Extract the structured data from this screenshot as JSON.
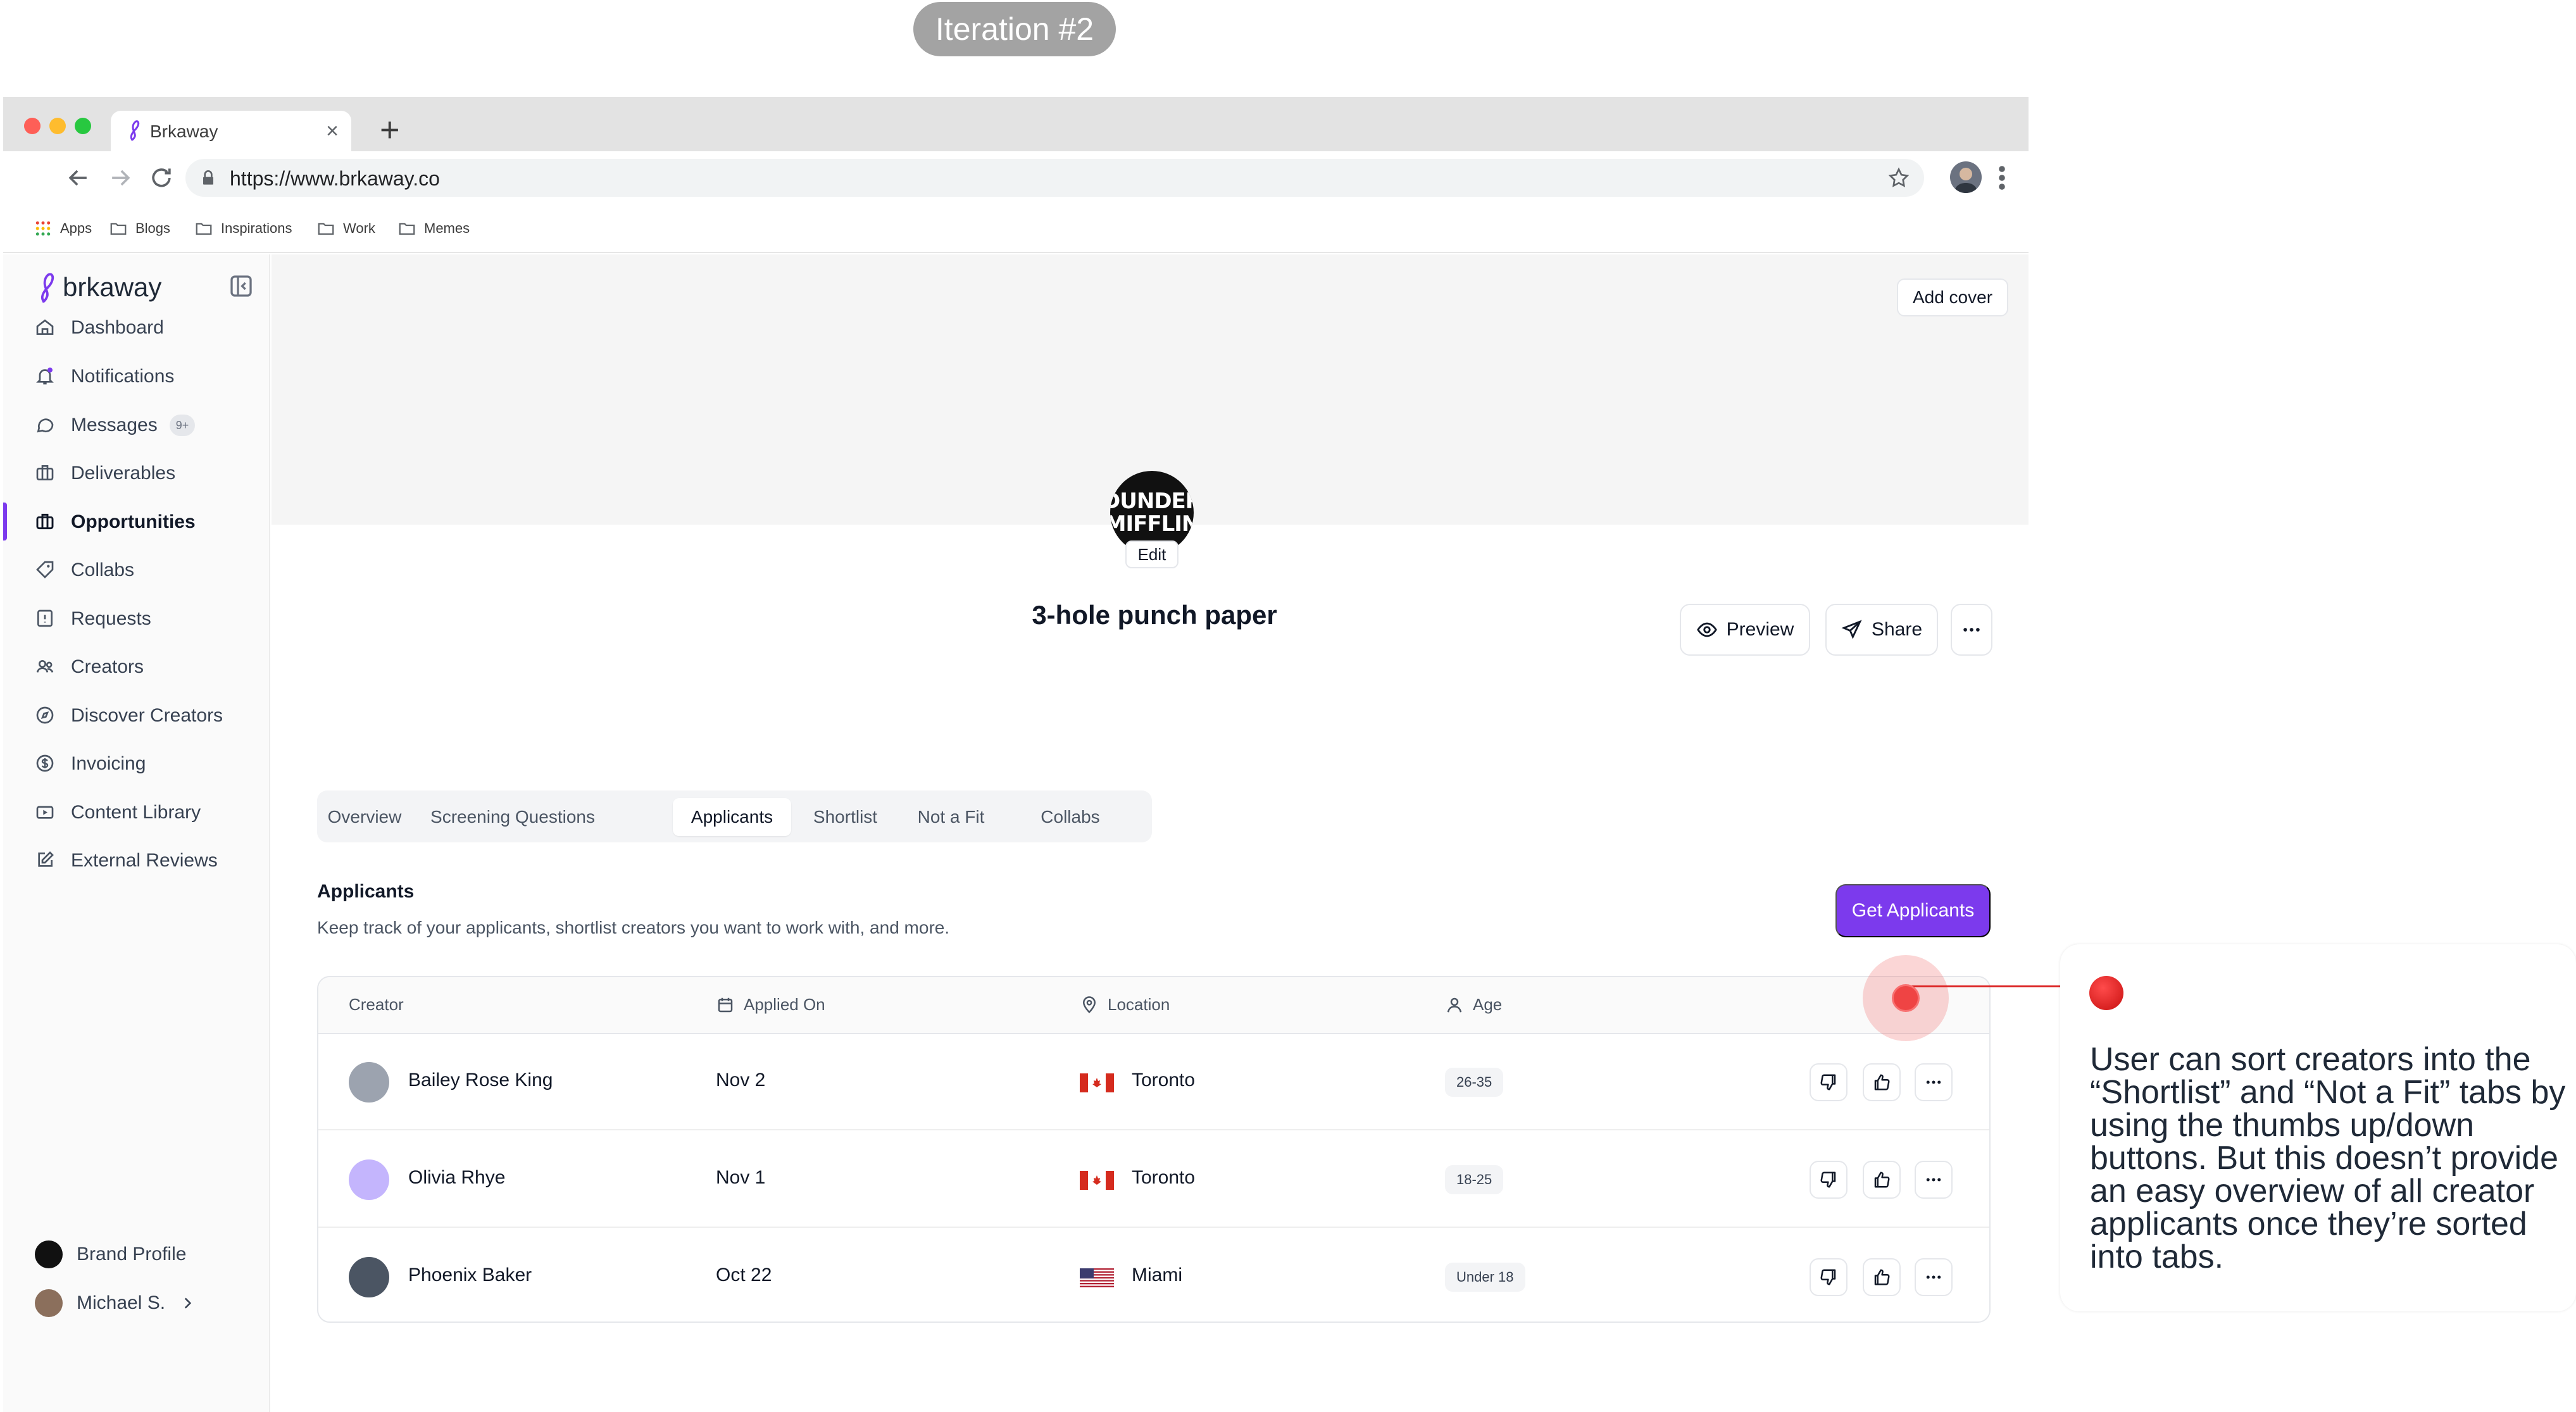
{
  "iteration_label": "Iteration #2",
  "browser": {
    "tab_title": "Brkaway",
    "url": "https://www.brkaway.co",
    "bookmarks": [
      "Apps",
      "Blogs",
      "Inspirations",
      "Work",
      "Memes"
    ]
  },
  "sidebar": {
    "brand": "brkaway",
    "items": [
      {
        "label": "Dashboard",
        "icon": "home-icon"
      },
      {
        "label": "Notifications",
        "icon": "bell-icon"
      },
      {
        "label": "Messages",
        "icon": "message-icon",
        "badge": "9+"
      },
      {
        "label": "Deliverables",
        "icon": "briefcase-icon"
      },
      {
        "label": "Opportunities",
        "icon": "briefcase-icon",
        "active": true
      },
      {
        "label": "Collabs",
        "icon": "tag-icon"
      },
      {
        "label": "Requests",
        "icon": "inbox-icon"
      },
      {
        "label": "Creators",
        "icon": "users-icon"
      },
      {
        "label": "Discover Creators",
        "icon": "compass-icon"
      },
      {
        "label": "Invoicing",
        "icon": "dollar-icon"
      },
      {
        "label": "Content Library",
        "icon": "video-icon"
      },
      {
        "label": "External Reviews",
        "icon": "edit-icon"
      }
    ],
    "footer": {
      "brand_profile": "Brand Profile",
      "user": "Michael S."
    }
  },
  "cover": {
    "add_cover": "Add cover",
    "logo_text_1": "DUNDER",
    "logo_text_2": "MIFFLIN",
    "edit": "Edit"
  },
  "opportunity": {
    "title": "3-hole punch paper",
    "preview": "Preview",
    "share": "Share"
  },
  "tabs": [
    "Overview",
    "Screening Questions",
    "Applicants",
    "Shortlist",
    "Not a Fit",
    "Collabs"
  ],
  "active_tab": "Applicants",
  "applicants_section": {
    "title": "Applicants",
    "subtitle": "Keep track of your applicants, shortlist creators you want to work with, and more.",
    "cta": "Get Applicants"
  },
  "table": {
    "columns": [
      "Creator",
      "Applied On",
      "Location",
      "Age"
    ],
    "rows": [
      {
        "name": "Bailey Rose King",
        "applied": "Nov 2",
        "location": "Toronto",
        "country": "Canada",
        "age": "26-35"
      },
      {
        "name": "Olivia Rhye",
        "applied": "Nov 1",
        "location": "Toronto",
        "country": "Canada",
        "age": "18-25"
      },
      {
        "name": "Phoenix Baker",
        "applied": "Oct 22",
        "location": "Miami",
        "country": "USA",
        "age": "Under 18"
      }
    ]
  },
  "annotation": {
    "text": "User can sort creators into the “Shortlist” and “Not a Fit” tabs by using the thumbs up/down buttons. But this doesn’t provide an easy overview of all creator applicants once they’re sorted into tabs."
  },
  "colors": {
    "accent": "#7c3aed",
    "hotspot": "#ef4444"
  }
}
